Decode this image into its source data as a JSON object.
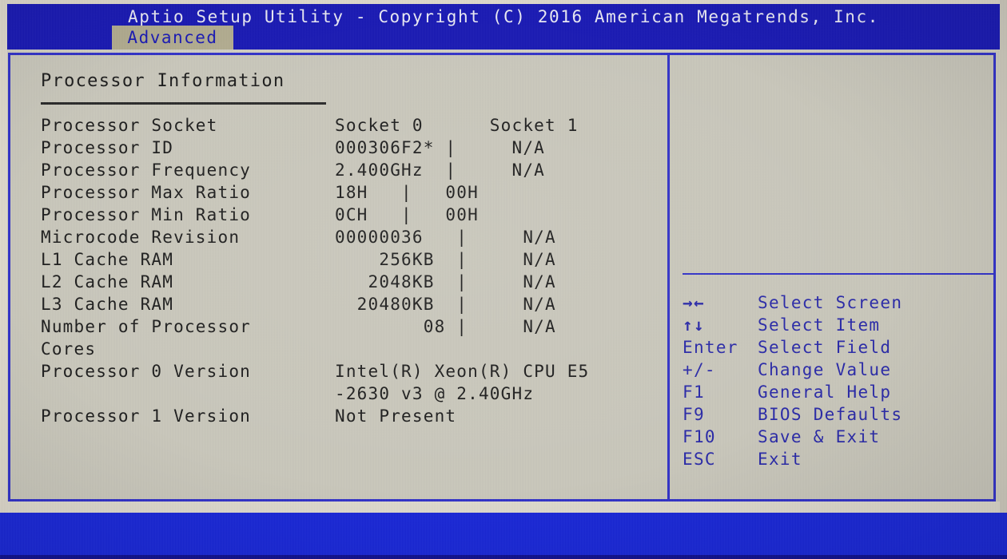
{
  "window": {
    "title": "Aptio Setup Utility - Copyright (C) 2016 American Megatrends, Inc.",
    "active_tab": "Advanced"
  },
  "colors": {
    "titlebar_blue": "#1a1ab4",
    "tab_background": "#b2ac90",
    "panel_background": "#c9c7bb",
    "border_blue": "#3232c8",
    "help_text_blue": "#2a2aa8",
    "body_text": "#1d1d1d",
    "footer_blue": "#1a28d8"
  },
  "main": {
    "section_title": "Processor Information",
    "column_headers": {
      "label": "Processor Socket",
      "socket0": "Socket 0",
      "socket1": "Socket 1",
      "combined": "Socket 0      Socket 1"
    },
    "rows": [
      {
        "label": "Processor Socket",
        "value": "Socket 0      Socket 1"
      },
      {
        "label": "Processor ID",
        "value": "000306F2* |     N/A"
      },
      {
        "label": "Processor Frequency",
        "value": "2.400GHz  |     N/A"
      },
      {
        "label": "Processor Max Ratio",
        "value": "18H   |   00H"
      },
      {
        "label": "Processor Min Ratio",
        "value": "0CH   |   00H"
      },
      {
        "label": "Microcode Revision",
        "value": "00000036   |     N/A"
      },
      {
        "label": "L1 Cache RAM",
        "value": "    256KB  |     N/A"
      },
      {
        "label": "L2 Cache RAM",
        "value": "   2048KB  |     N/A"
      },
      {
        "label": "L3 Cache RAM",
        "value": "  20480KB  |     N/A"
      },
      {
        "label": "Number of Processor",
        "value": "        08 |     N/A"
      },
      {
        "label": "Cores",
        "value": ""
      },
      {
        "label": "Processor 0 Version",
        "value": "Intel(R) Xeon(R) CPU E5"
      },
      {
        "label": "",
        "value": "-2630 v3 @ 2.40GHz"
      },
      {
        "label": "Processor 1 Version",
        "value": "Not Present"
      }
    ]
  },
  "help": {
    "items": [
      {
        "key": "→←",
        "icon": "left-right-arrow-icon",
        "desc": "Select Screen",
        "is_text_key": false
      },
      {
        "key": "↑↓",
        "icon": "up-down-arrow-icon",
        "desc": "Select Item",
        "is_text_key": false
      },
      {
        "key": "Enter",
        "icon": "enter-key-icon",
        "desc": "Select Field",
        "is_text_key": true
      },
      {
        "key": "+/-",
        "icon": "plus-minus-key-icon",
        "desc": "Change Value",
        "is_text_key": true
      },
      {
        "key": "F1",
        "icon": "f1-key-icon",
        "desc": "General Help",
        "is_text_key": true
      },
      {
        "key": "F9",
        "icon": "f9-key-icon",
        "desc": "BIOS Defaults",
        "is_text_key": true
      },
      {
        "key": "F10",
        "icon": "f10-key-icon",
        "desc": "Save & Exit",
        "is_text_key": true
      },
      {
        "key": "ESC",
        "icon": "esc-key-icon",
        "desc": "Exit",
        "is_text_key": true
      }
    ]
  }
}
